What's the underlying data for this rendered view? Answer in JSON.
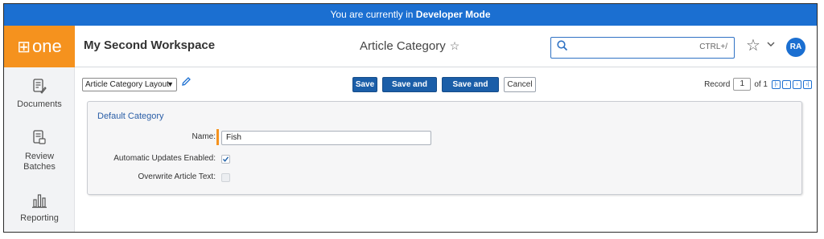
{
  "devbar": {
    "prefix": "You are currently in ",
    "mode": "Developer Mode"
  },
  "header": {
    "logo_text": "one",
    "logo_glyph": "⊞",
    "workspace": "My Second Workspace",
    "page_title": "Article Category",
    "search": {
      "shortcut": "CTRL+/",
      "placeholder": ""
    },
    "avatar": "RA"
  },
  "sidebar": {
    "items": [
      {
        "label": "Documents",
        "icon": "documents-icon"
      },
      {
        "label": "Review Batches",
        "icon": "review-batches-icon"
      },
      {
        "label": "Reporting",
        "icon": "reporting-icon"
      }
    ]
  },
  "toolbar": {
    "layout": "Article Category Layout",
    "save": "Save",
    "save_and_new": "Save and New",
    "save_and_back": "Save and Back",
    "cancel": "Cancel",
    "record_label": "Record",
    "record_value": "1",
    "record_total": "of 1"
  },
  "form": {
    "section_title": "Default Category",
    "name_label": "Name:",
    "name_value": "Fish",
    "auto_updates_label": "Automatic Updates Enabled:",
    "auto_updates_checked": true,
    "overwrite_label": "Overwrite Article Text:",
    "overwrite_checked": false
  },
  "colors": {
    "accent": "#1b6fd1",
    "brand": "#f5921e",
    "primary_button": "#1b5ea8"
  }
}
